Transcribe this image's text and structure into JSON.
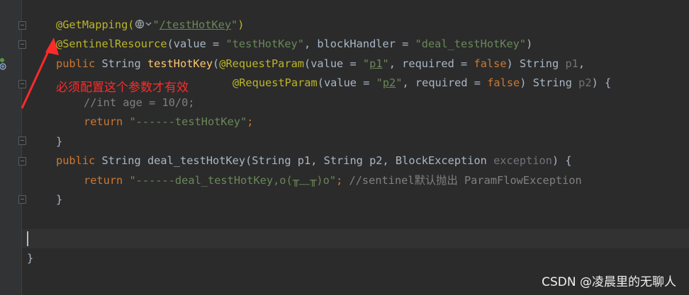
{
  "colors": {
    "background": "#2b2b2b",
    "annotation": "#bbb529",
    "keyword": "#cc7832",
    "string": "#6a8759",
    "method": "#ffc66d",
    "comment": "#808080",
    "note": "#ff2a2a"
  },
  "code": {
    "l1": {
      "ann": "@GetMapping(",
      "icon": "globe-icon",
      "str_open": "\"",
      "path": "/testHotKey",
      "str_close": "\"",
      "close": ")"
    },
    "l2": {
      "ann": "@SentinelResource",
      "p1": "(value = ",
      "s1": "\"testHotKey\"",
      "p2": ", blockHandler = ",
      "s2": "\"deal_testHotKey\"",
      "p3": ")"
    },
    "l3": {
      "kw": "public ",
      "type": "String ",
      "fn": "testHotKey",
      "p0": "(",
      "ann": "@RequestParam",
      "p1": "(value = ",
      "q1": "\"",
      "v": "p1",
      "q2": "\"",
      "p2": ", required = ",
      "kw2": "false",
      "p3": ") String ",
      "param": "p1",
      "p4": ","
    },
    "l4": {
      "ann": "@RequestParam",
      "p1": "(value = ",
      "q1": "\"",
      "v": "p2",
      "q2": "\"",
      "p2": ", required = ",
      "kw2": "false",
      "p3": ") String ",
      "param": "p2",
      "p4": ") {"
    },
    "l5": "//int age = 10/0;",
    "l6": {
      "kw": "return ",
      "str": "\"------testHotKey\"",
      "end": ";"
    },
    "l7": "}",
    "l8": {
      "kw": "public ",
      "p1": "String ",
      "fn": "deal_testHotKey",
      "p2": "(String ",
      "a": "p1",
      "p3": ", String ",
      "b": "p2",
      "p4": ", BlockException ",
      "c": "exception",
      "p5": ") {"
    },
    "l9": {
      "kw": "return ",
      "str": "\"------deal_testHotKey,o(╥﹏╥)o\"",
      "end": "; ",
      "cm": "//sentinel默认抛出 ParamFlowException"
    },
    "l10": "}",
    "l11": "}"
  },
  "annotation_note": "必须配置这个参数才有效",
  "watermark": "CSDN @凌晨里的无聊人"
}
